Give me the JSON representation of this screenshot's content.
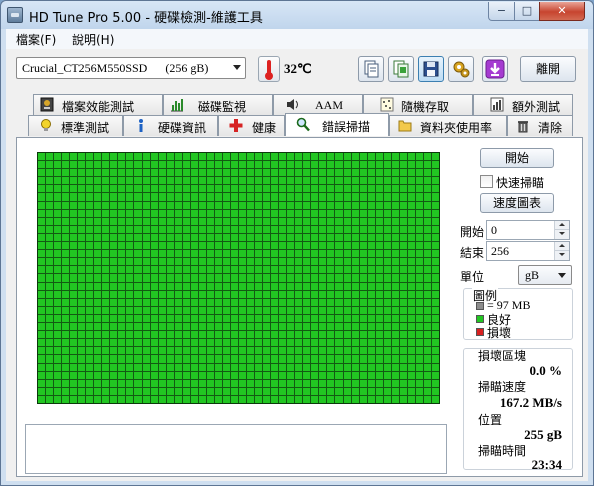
{
  "window": {
    "title": "HD Tune Pro  5.00 - 硬碟檢測-維護工具",
    "minimize_glyph": "−",
    "maximize_glyph": "□",
    "close_glyph": "✕"
  },
  "menu": [
    {
      "label": "檔案(F)"
    },
    {
      "label": "說明(H)"
    }
  ],
  "toolbar": {
    "drive": "Crucial_CT256M550SSD      (256 gB)",
    "temperature": "32℃",
    "exit_label": "離開",
    "buttons": [
      "copy-info-icon",
      "copy-screen-icon",
      "save-icon",
      "options-icon",
      "download-icon"
    ]
  },
  "tabs": {
    "row1": [
      {
        "label": "檔案效能測試",
        "icon": "file-benchmark-icon"
      },
      {
        "label": "磁碟監視",
        "icon": "disk-monitor-icon"
      },
      {
        "label": "AAM",
        "icon": "speaker-icon"
      },
      {
        "label": "隨機存取",
        "icon": "random-access-icon"
      },
      {
        "label": "額外測試",
        "icon": "extra-tests-icon"
      }
    ],
    "row2": [
      {
        "label": "標準測試",
        "icon": "lightbulb-icon"
      },
      {
        "label": "硬碟資訊",
        "icon": "info-icon"
      },
      {
        "label": "健康",
        "icon": "health-cross-icon"
      },
      {
        "label": "錯誤掃描",
        "icon": "magnifier-icon",
        "active": true
      },
      {
        "label": "資料夾使用率",
        "icon": "folder-icon"
      },
      {
        "label": "清除",
        "icon": "trash-icon"
      }
    ]
  },
  "scan": {
    "start_button": "開始",
    "quick_scan_label": "快速掃瞄",
    "quick_scan_checked": false,
    "speed_map_button": "速度圖表",
    "start_label": "開始",
    "start_value": "0",
    "end_label": "結束",
    "end_value": "256",
    "unit_label": "單位",
    "unit_value": "gB",
    "legend_title": "圖例",
    "legend": [
      {
        "text": "= 97 MB",
        "color": "#8c8c8c"
      },
      {
        "text": "良好",
        "color": "#22c622"
      },
      {
        "text": "損壞",
        "color": "#d82020"
      }
    ],
    "damaged_blocks_label": "損壞區塊",
    "damaged_blocks_value": "0.0 %",
    "scan_speed_label": "掃瞄速度",
    "scan_speed_value": "167.2 MB/s",
    "position_label": "位置",
    "position_value": "255 gB",
    "elapsed_label": "掃瞄時間",
    "elapsed_value": "23:34",
    "block_status": "all-good",
    "colors": {
      "good": "#22c622",
      "grid_line": "#135a13"
    }
  }
}
